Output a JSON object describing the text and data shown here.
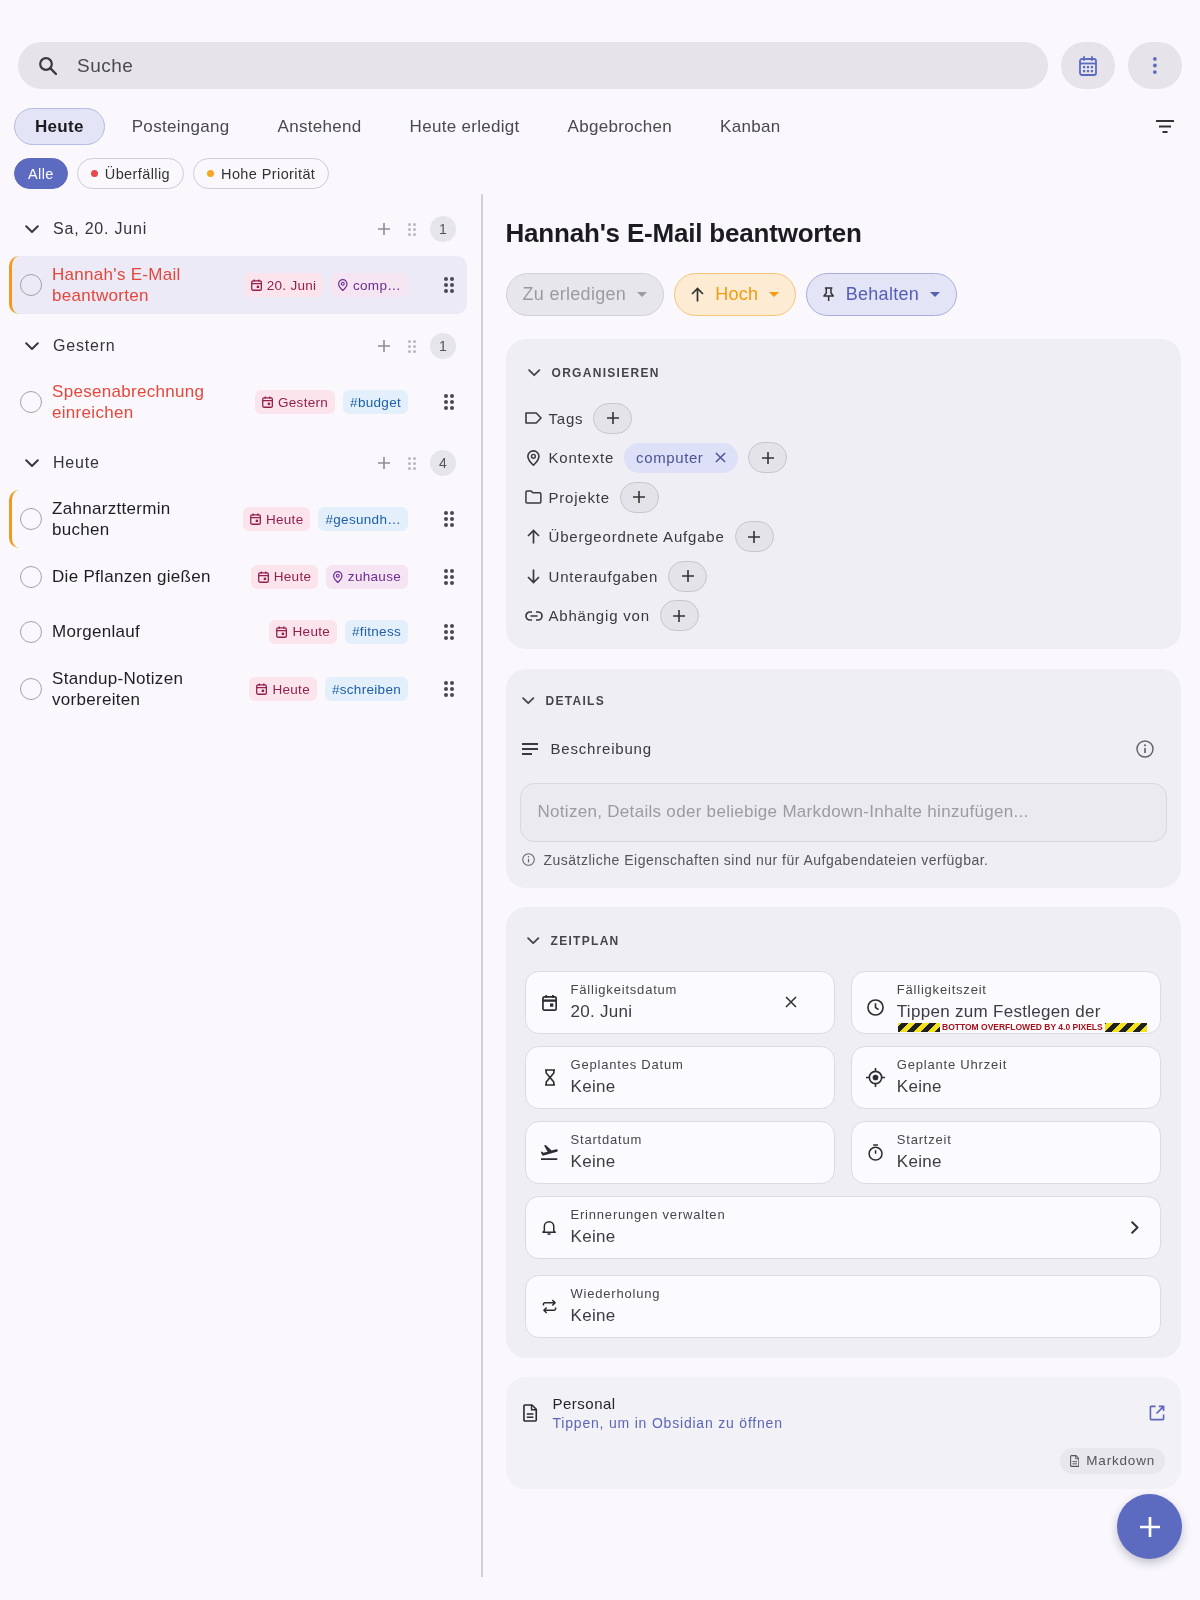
{
  "search": {
    "placeholder": "Suche"
  },
  "tabs": [
    {
      "label": "Heute",
      "selected": true
    },
    {
      "label": "Posteingang",
      "selected": false
    },
    {
      "label": "Anstehend",
      "selected": false
    },
    {
      "label": "Heute erledigt",
      "selected": false
    },
    {
      "label": "Abgebrochen",
      "selected": false
    },
    {
      "label": "Kanban",
      "selected": false
    }
  ],
  "filters": [
    {
      "label": "Alle",
      "selected": true
    },
    {
      "label": "Überfällig",
      "selected": false,
      "color": "#e5484d"
    },
    {
      "label": "Hohe Priorität",
      "selected": false,
      "color": "#f5a623"
    }
  ],
  "groups": [
    {
      "title": "Sa, 20. Juni",
      "expanded": true,
      "count": "1",
      "tasks": [
        {
          "title": "Hannah's E-Mail beantworten",
          "done": false,
          "overdue": true,
          "high_priority": true,
          "selected": true,
          "chips": [
            {
              "kind": "date",
              "label": "20. Juni"
            },
            {
              "kind": "context",
              "label": "comp…"
            }
          ]
        }
      ]
    },
    {
      "title": "Gestern",
      "expanded": true,
      "count": "1",
      "tasks": [
        {
          "title": "Spesenabrechnung einreichen",
          "done": false,
          "overdue": true,
          "high_priority": false,
          "selected": false,
          "chips": [
            {
              "kind": "date",
              "label": "Gestern"
            },
            {
              "kind": "tag",
              "label": "#budget"
            }
          ]
        }
      ]
    },
    {
      "title": "Heute",
      "expanded": true,
      "count": "4",
      "tasks": [
        {
          "title": "Zahnarzttermin buchen",
          "done": false,
          "overdue": false,
          "high_priority": true,
          "selected": false,
          "chips": [
            {
              "kind": "date",
              "label": "Heute"
            },
            {
              "kind": "tag",
              "label": "#gesundh…"
            }
          ]
        },
        {
          "title": "Die Pflanzen gießen",
          "done": false,
          "overdue": false,
          "high_priority": false,
          "selected": false,
          "chips": [
            {
              "kind": "date",
              "label": "Heute"
            },
            {
              "kind": "context",
              "label": "zuhause"
            }
          ]
        },
        {
          "title": "Morgenlauf",
          "done": false,
          "overdue": false,
          "high_priority": false,
          "selected": false,
          "chips": [
            {
              "kind": "date",
              "label": "Heute"
            },
            {
              "kind": "tag",
              "label": "#fitness"
            }
          ]
        },
        {
          "title": "Standup-Notizen vorbereiten",
          "done": false,
          "overdue": false,
          "high_priority": false,
          "selected": false,
          "chips": [
            {
              "kind": "date",
              "label": "Heute"
            },
            {
              "kind": "tag",
              "label": "#schreiben"
            }
          ]
        }
      ]
    }
  ],
  "detail": {
    "title": "Hannah's E-Mail beantworten",
    "chips": [
      {
        "kind": "status",
        "label": "Zu erledigen"
      },
      {
        "kind": "priority",
        "label": "Hoch"
      },
      {
        "kind": "pin",
        "label": "Behalten"
      }
    ],
    "organize": {
      "title": "ORGANISIEREN",
      "expanded": true,
      "rows": [
        {
          "kind": "tags",
          "label": "Tags"
        },
        {
          "kind": "contexts",
          "label": "Kontexte",
          "values": [
            "computer"
          ]
        },
        {
          "kind": "projects",
          "label": "Projekte"
        },
        {
          "kind": "parent",
          "label": "Übergeordnete Aufgabe"
        },
        {
          "kind": "subtasks",
          "label": "Unteraufgaben"
        },
        {
          "kind": "depends",
          "label": "Abhängig von"
        }
      ]
    },
    "details": {
      "title": "DETAILS",
      "expanded": true,
      "field_label": "Beschreibung",
      "description": {
        "placeholder": "Notizen, Details oder beliebige Markdown-Inhalte hinzufügen..."
      },
      "note": "Zusätzliche Eigenschaften sind nur für Aufgabendateien verfügbar."
    },
    "schedule": {
      "title": "ZEITPLAN",
      "expanded": true,
      "fields": [
        {
          "kind": "due_date",
          "label": "Fälligkeitsdatum",
          "value": "20. Juni",
          "clearable": true
        },
        {
          "kind": "due_time",
          "label": "Fälligkeitszeit",
          "value": "Tippen zum Festlegen der",
          "clearable": false,
          "overflow_warning": "BOTTOM OVERFLOWED BY 4.0 PIXELS"
        },
        {
          "kind": "scheduled_date",
          "label": "Geplantes Datum",
          "value": "Keine",
          "clearable": false
        },
        {
          "kind": "scheduled_time",
          "label": "Geplante Uhrzeit",
          "value": "Keine",
          "clearable": false
        },
        {
          "kind": "start_date",
          "label": "Startdatum",
          "value": "Keine",
          "clearable": false
        },
        {
          "kind": "start_time",
          "label": "Startzeit",
          "value": "Keine",
          "clearable": false
        },
        {
          "kind": "reminders",
          "label": "Erinnerungen verwalten",
          "value": "Keine",
          "clearable": false
        },
        {
          "kind": "recurrence",
          "label": "Wiederholung",
          "value": "Keine",
          "clearable": false
        }
      ]
    },
    "file": {
      "name": "Personal",
      "link": "Tippen, um in Obsidian zu öffnen",
      "format": "Markdown"
    }
  }
}
